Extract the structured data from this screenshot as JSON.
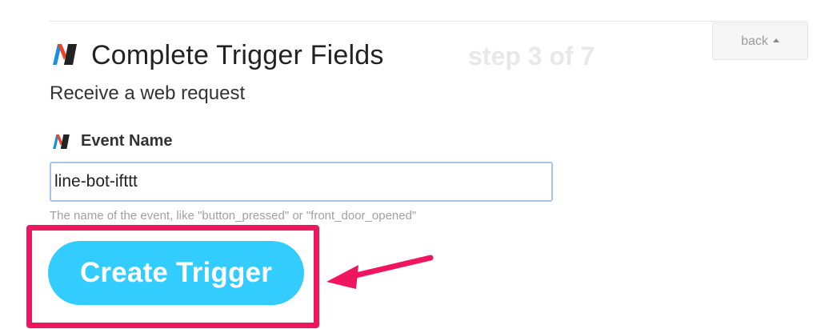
{
  "header": {
    "title": "Complete Trigger Fields",
    "step": "step 3 of 7",
    "back_label": "back"
  },
  "trigger": {
    "subtitle": "Receive a web request"
  },
  "field": {
    "label": "Event Name",
    "value": "line-bot-ifttt",
    "help": "The name of the event, like \"button_pressed\" or \"front_door_opened\""
  },
  "actions": {
    "create_label": "Create Trigger"
  },
  "icons": {
    "service_logo": "maker-webhooks-logo",
    "back_caret": "caret-up-icon",
    "annotation": "arrow-pointer-icon"
  },
  "colors": {
    "button_bg": "#33ccff",
    "highlight": "#f0155f",
    "step_text": "#e8e8e8",
    "input_border": "#a9c4ea",
    "logo_blue": "#1a8fe3",
    "logo_red": "#f2432a"
  }
}
